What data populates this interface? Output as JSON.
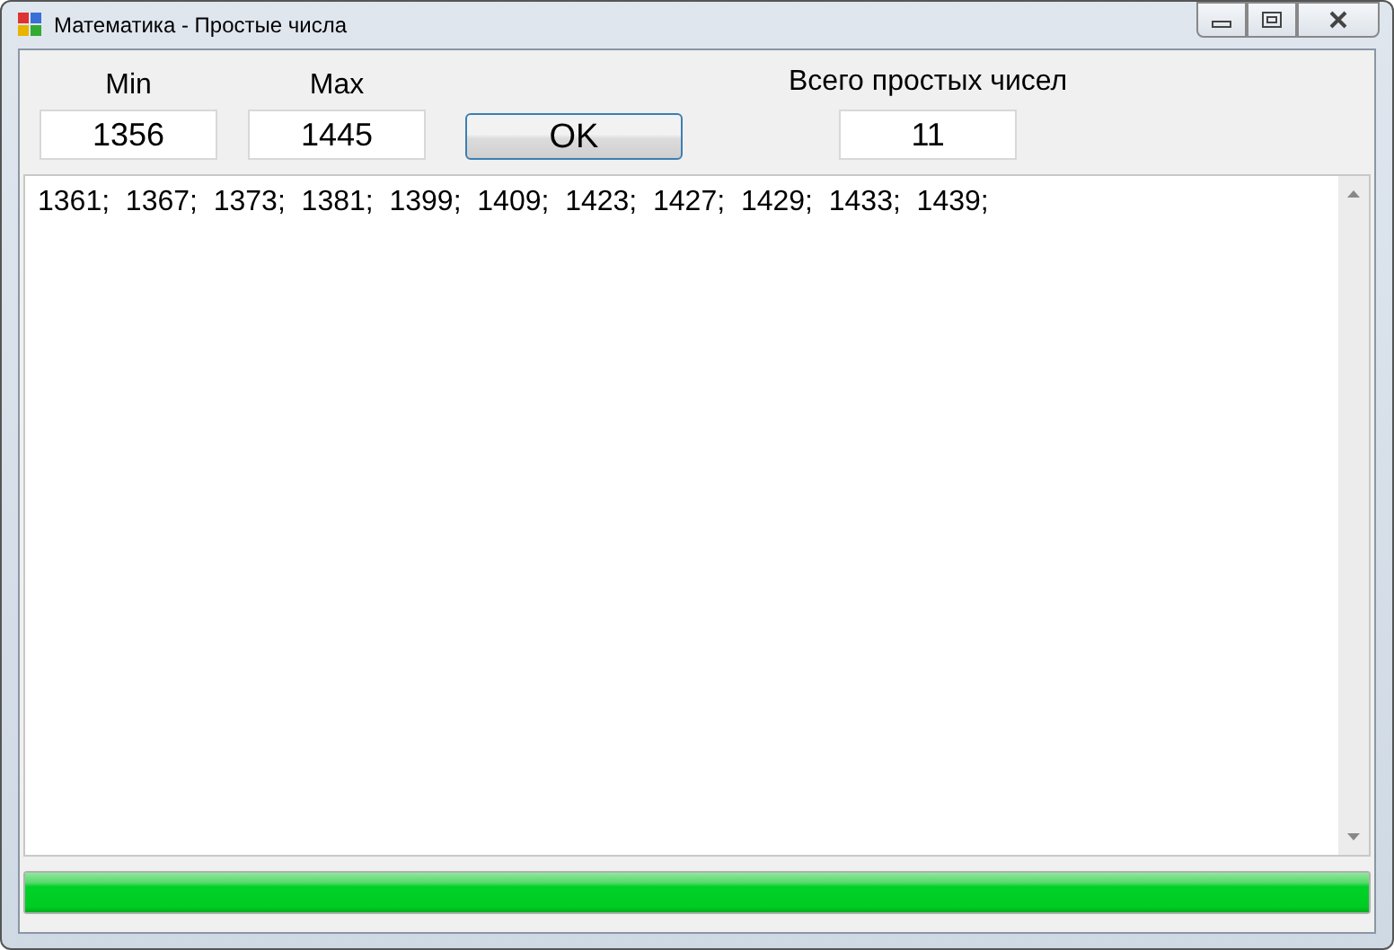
{
  "window": {
    "title": "Математика - Простые числа"
  },
  "min": {
    "label": "Min",
    "value": "1356"
  },
  "max": {
    "label": "Max",
    "value": "1445"
  },
  "ok_button": "OK",
  "count": {
    "label": "Всего простых чисел",
    "value": "11"
  },
  "result": "1361;  1367;  1373;  1381;  1399;  1409;  1423;  1427;  1429;  1433;  1439;",
  "progress": {
    "level": 1
  }
}
